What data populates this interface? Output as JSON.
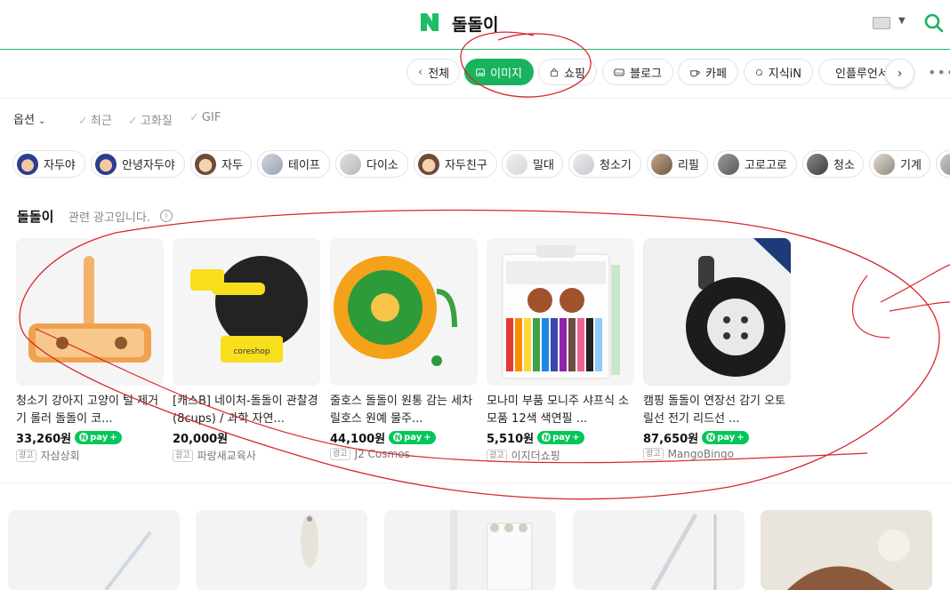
{
  "header": {
    "query": "돌돌이",
    "logo": "N"
  },
  "tabs": [
    {
      "label": "전체",
      "icon": "chevron-left-icon"
    },
    {
      "label": "이미지",
      "icon": "image-icon",
      "active": true
    },
    {
      "label": "쇼핑",
      "icon": "bag-icon"
    },
    {
      "label": "블로그",
      "icon": "blog-icon"
    },
    {
      "label": "카페",
      "icon": "cafe-icon"
    },
    {
      "label": "지식iN",
      "icon": "qna-icon"
    },
    {
      "label": "인플루언서",
      "icon": "person-icon"
    }
  ],
  "options": {
    "label": "옵션",
    "filters": [
      "최근",
      "고화질",
      "GIF"
    ]
  },
  "chips": [
    "자두야",
    "안녕자두야",
    "자두",
    "테이프",
    "다이소",
    "자두친구",
    "밀대",
    "청소기",
    "리필",
    "고로고로",
    "청소",
    "기계"
  ],
  "ad_section": {
    "title": "돌돌이",
    "subtitle": "관련 광고입니다.",
    "ad_badge": "광고",
    "npay": "pay",
    "products": [
      {
        "title": "청소기 강아지 고양이 털 제거기 롤러 돌돌이 코...",
        "price": "33,260원",
        "seller": "자삼상회"
      },
      {
        "title": "[캐스B] 네이처-돌돌이 관찰경(8cups) / 과학 자연...",
        "price": "20,000원",
        "seller": "파랑새교육사"
      },
      {
        "title": "줄호스 돌돌이 원통 감는 세차 릴호스 원예 물주...",
        "price": "44,100원",
        "seller": "J2 Cosmos"
      },
      {
        "title": "모나미 부품 모니주 샤프식 소모품 12색 색연필 ...",
        "price": "5,510원",
        "seller": "이지더쇼핑"
      },
      {
        "title": "캠핑 돌돌이 연장선 감기 오토 릴선 전기 리드선 ...",
        "price": "87,650원",
        "seller": "MangoBingo"
      }
    ]
  },
  "colors": {
    "brand": "#19b35e",
    "npay": "#03c75a",
    "annotation": "#d9262c"
  }
}
